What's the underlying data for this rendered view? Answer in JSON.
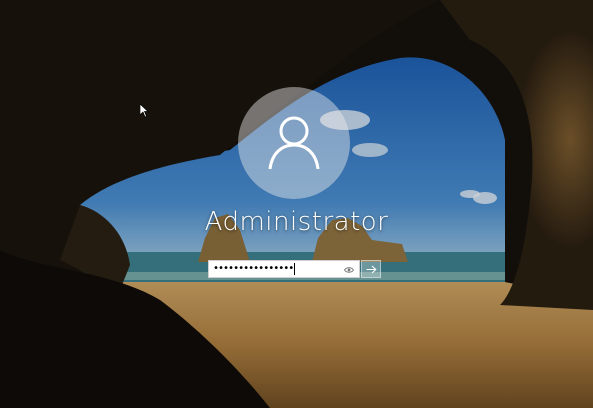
{
  "user": {
    "name": "Administrator"
  },
  "password": {
    "masked_value": "••••••••••••••••"
  },
  "icons": {
    "avatar": "user-silhouette-icon",
    "reveal": "eye-icon",
    "submit": "arrow-right-icon",
    "cursor": "mouse-pointer-icon"
  },
  "colors": {
    "sky": "#2f6fb8",
    "sea": "#3c7f8c",
    "sand": "#b88f4f",
    "cave": "#1a140d"
  }
}
